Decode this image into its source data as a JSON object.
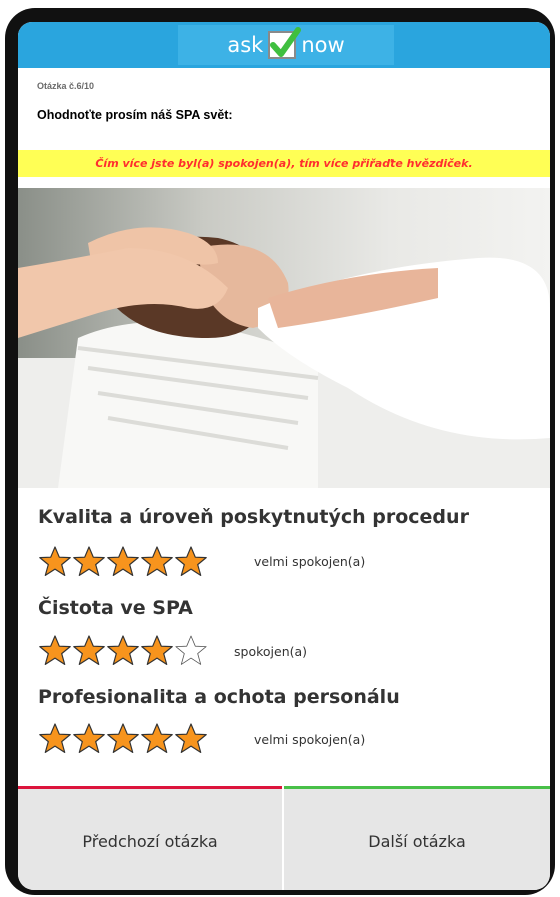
{
  "header": {
    "logo_left": "ask",
    "logo_right": "now"
  },
  "question": {
    "number": "Otázka č.6/10",
    "title": "Ohodnoťte prosím náš SPA svět:",
    "hint": "Čím více jste byl(a) spokojen(a), tím více přiřaďte hvězdiček."
  },
  "colors": {
    "header_bar": "#2aa5de",
    "hint_background": "#ffff55",
    "hint_text": "#ff2e2e",
    "star_fill": "#f7941d",
    "prev_accent": "#dc143c",
    "next_accent": "#48c048"
  },
  "ratings": [
    {
      "label": "Kvalita a úroveň poskytnutých procedur",
      "stars": 5,
      "max": 5,
      "value_text": "velmi spokojen(a)"
    },
    {
      "label": "Čistota ve SPA",
      "stars": 4,
      "max": 5,
      "value_text": "spokojen(a)"
    },
    {
      "label": "Profesionalita a ochota personálu",
      "stars": 5,
      "max": 5,
      "value_text": "velmi spokojen(a)"
    }
  ],
  "navigation": {
    "prev_label": "Předchozí otázka",
    "next_label": "Další otázka"
  }
}
